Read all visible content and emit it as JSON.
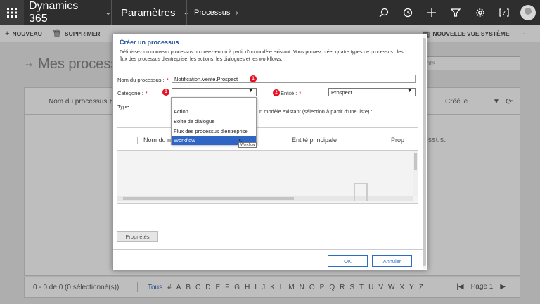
{
  "app": {
    "name": "Dynamics 365",
    "area": "Paramètres",
    "breadcrumb": "Processus"
  },
  "nav_icons": [
    "search-icon",
    "history-icon",
    "plus-icon",
    "filter-icon",
    "gear-icon",
    "help-icon",
    "avatar"
  ],
  "commands": [
    {
      "label": "NOUVEAU",
      "icon": "plus-icon"
    },
    {
      "label": "SUPPRIMER",
      "icon": "trash-icon"
    }
  ],
  "commands_right": {
    "label": "NOUVELLE VUE SYSTÈME",
    "more": "···"
  },
  "background": {
    "title": "Mes processus",
    "search_placeholder": "ments",
    "col_name": "Nom du processus ↑",
    "col_created": "Créé le",
    "empty_text": "cessus.",
    "selection": "0 - 0 de 0 (0 sélectionné(s))",
    "alpha_first": "Tous",
    "alpha": [
      "#",
      "A",
      "B",
      "C",
      "D",
      "E",
      "F",
      "G",
      "H",
      "I",
      "J",
      "K",
      "L",
      "M",
      "N",
      "O",
      "P",
      "Q",
      "R",
      "S",
      "T",
      "U",
      "V",
      "W",
      "X",
      "Y",
      "Z"
    ],
    "page": "Page 1"
  },
  "dialog": {
    "title": "Créer un processus",
    "description": "Définissez un nouveau processus ou créez-en un à partir d'un modèle existant. Vous pouvez créer quatre types de processus : les flux des processus d'entreprise, les actions, les dialogues et les workflows.",
    "name_label": "Nom du processus :",
    "name_value": "Notification.Vente.Prospect",
    "category_label": "Catégorie :",
    "category_value": "",
    "entity_label": "Entité :",
    "entity_value": "Prospect",
    "type_label": "Type :",
    "template_text": "n modèle existant (sélection à partir d'une liste) :",
    "grid_col1": "Nom du n",
    "grid_col2": "Entité principale",
    "grid_col3": "Prop",
    "props_button": "Propriétés",
    "ok_button": "OK",
    "cancel_button": "Annuler",
    "badges": [
      "1",
      "2",
      "3"
    ]
  },
  "dropdown": {
    "options": [
      "Action",
      "Boîte de dialogue",
      "Flux des processus d'entreprise",
      "Workflow"
    ],
    "highlighted": "Workflow",
    "tooltip": "Workflow"
  },
  "colors": {
    "topbar": "#2e2e2e",
    "accent": "#2f66c5",
    "badge": "#e81123",
    "title_blue": "#1f4e9c"
  }
}
